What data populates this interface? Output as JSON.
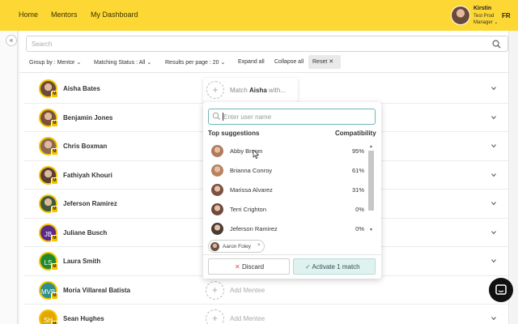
{
  "nav": {
    "home": "Home",
    "mentors": "Mentors",
    "dashboard": "My Dashboard"
  },
  "user": {
    "name": "Kirstin",
    "role": "Test Prod Manager",
    "lang": "FR"
  },
  "search": {
    "placeholder": "Search"
  },
  "filters": {
    "group_by": "Group by : Mentor",
    "matching_status": "Matching Status : All",
    "results_per_page": "Results per page : 20",
    "expand_all": "Expand all",
    "collapse_all": "Collapse all",
    "reset": "Reset"
  },
  "mentors": [
    {
      "name": "Aisha Bates",
      "initials": "",
      "avatar_color": "#6a4a38",
      "badge": "M"
    },
    {
      "name": "Benjamin Jones",
      "initials": "",
      "avatar_color": "#7a5138",
      "badge": "M"
    },
    {
      "name": "Chris Boxman",
      "initials": "",
      "avatar_color": "#8a6a52",
      "badge": "M"
    },
    {
      "name": "Fathiyah Khouri",
      "initials": "",
      "avatar_color": "#5a4033",
      "badge": "M"
    },
    {
      "name": "Jeferson Ramirez",
      "initials": "",
      "avatar_color": "#3e5a3a",
      "badge": "M"
    },
    {
      "name": "Juliane Busch",
      "initials": "JB",
      "avatar_color": "#5b2a86",
      "badge": "M"
    },
    {
      "name": "Laura Smith",
      "initials": "LS",
      "avatar_color": "#1f8a2e",
      "badge": "M"
    },
    {
      "name": "Moria Villareal Batista",
      "initials": "MVB",
      "avatar_color": "#2f8f8a",
      "badge": "M"
    },
    {
      "name": "Sean Hughes",
      "initials": "SH",
      "avatar_color": "#e0a800",
      "badge": "M"
    }
  ],
  "add_mentee_label": "Add Mentee",
  "match_card": {
    "prefix": "Match ",
    "name": "Aisha",
    "suffix": " with..."
  },
  "popover": {
    "search_placeholder": "Enter user name",
    "top_suggestions": "Top suggestions",
    "compatibility": "Compatibility",
    "suggestions": [
      {
        "name": "Abby Brown",
        "pct": "95%",
        "color": "#b07a5c"
      },
      {
        "name": "Brianna Conroy",
        "pct": "61%",
        "color": "#b8835e"
      },
      {
        "name": "Marissa Alvarez",
        "pct": "31%",
        "color": "#7b5242"
      },
      {
        "name": "Terri Crighton",
        "pct": "0%",
        "color": "#6c4a3c"
      },
      {
        "name": "Jeferson Ramirez",
        "pct": "0%",
        "color": "#4a3b33"
      }
    ],
    "selected_chip": "Aaron Foley",
    "discard": "Discard",
    "activate": "Activate 1 match"
  },
  "colors": {
    "topbar": "#fdd835",
    "accent": "#6fb6bb",
    "activate_bg": "#dff2f0"
  }
}
